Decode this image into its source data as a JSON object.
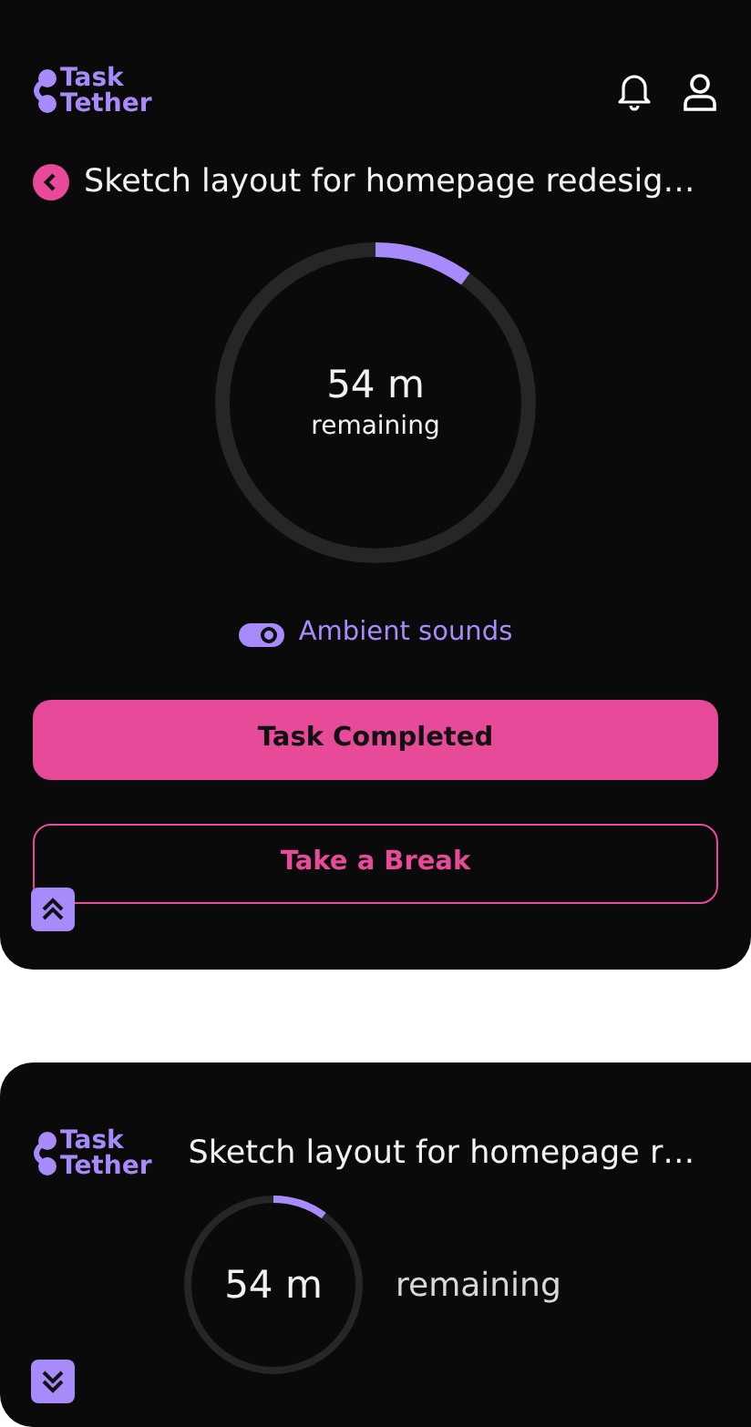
{
  "expanded_view": {
    "logo": {
      "line1": "Task",
      "line2": "Tether"
    },
    "task_title": "Sketch layout for homepage redesig…",
    "timer": {
      "level": 0.1,
      "value": "54 m",
      "label": "remaining"
    },
    "ambient_sounds": {
      "label": "Ambient sounds",
      "on": true
    },
    "buttons": [
      {
        "label": "Task Completed",
        "kind": "primary"
      },
      {
        "label": "Take a Break",
        "kind": "outline"
      }
    ],
    "toggle": {
      "expanded": true
    }
  },
  "compact_view": {
    "logo": {
      "line1": "Task",
      "line2": "Tether"
    },
    "task_title": "Sketch layout for homepage r…",
    "timer": {
      "level": 0.1,
      "value": "54 m",
      "label": "remaining"
    },
    "toggle": {
      "expanded": false
    }
  }
}
